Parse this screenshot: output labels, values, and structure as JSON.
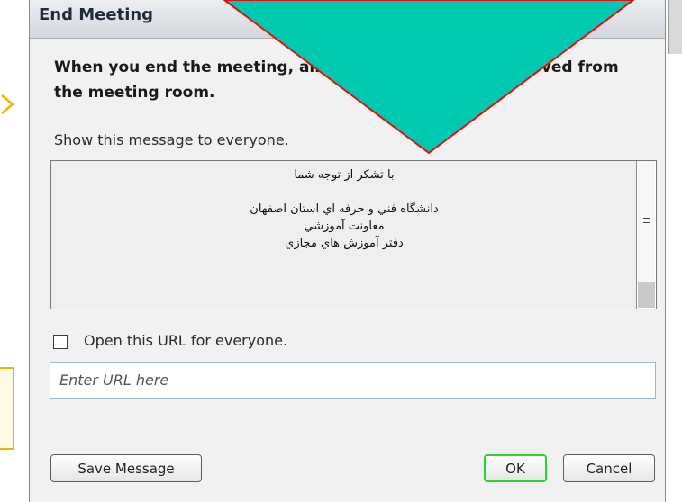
{
  "dialog": {
    "title": "End Meeting",
    "notice": "When you end the meeting, all participants will be removed from the meeting room.",
    "show_message_label": "Show this message to everyone.",
    "message_lines": [
      "با تشكر از توجه شما",
      "",
      "دانشگاه فني و حرفه اي استان اصفهان",
      "معاونت آموزشي",
      "دفتر آموزش هاي مجازي"
    ],
    "url_checkbox_label": "Open this URL for everyone.",
    "url_checkbox_checked": false,
    "url_placeholder": "Enter URL here",
    "url_value": "",
    "buttons": {
      "save_message": "Save Message",
      "ok": "OK",
      "cancel": "Cancel"
    }
  },
  "colors": {
    "overlay_fill": "#00c9b2",
    "overlay_stroke": "#e01010",
    "ok_focus_ring": "#2fd12f",
    "side_note_border": "#f0b400"
  }
}
